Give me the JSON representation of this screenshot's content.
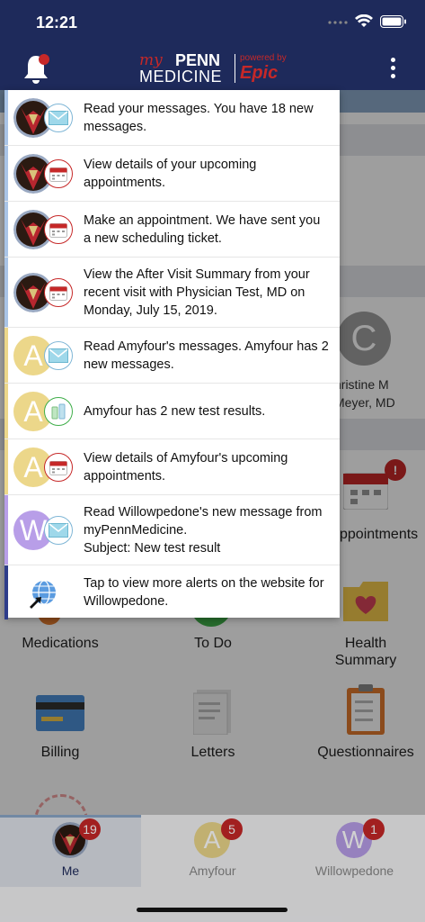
{
  "status_bar": {
    "time": "12:21"
  },
  "header": {
    "logo_my": "my",
    "logo_penn": "PENN",
    "logo_medicine": "MEDICINE",
    "powered_by": "powered by",
    "epic": "Epic"
  },
  "background": {
    "provider_initial": "C",
    "provider_line1": "hristine M",
    "provider_line2": "Meyer, MD",
    "appointments_label": "ppointments",
    "appointments_badge": "!",
    "tiles": {
      "medications": "Medications",
      "todo": "To Do",
      "health_summary": "Health\nSummary",
      "billing": "Billing",
      "letters": "Letters",
      "questionnaires": "Questionnaires"
    }
  },
  "alerts": [
    {
      "text": "Read your messages. You have 18 new messages.",
      "avatar": "me",
      "icon": "mail-icon",
      "bar_color": "#a9c4e6"
    },
    {
      "text": "View details of your upcoming appointments.",
      "avatar": "me",
      "icon": "calendar-icon",
      "bar_color": "#a9c4e6"
    },
    {
      "text": "Make an appointment. We have sent you a new scheduling ticket.",
      "avatar": "me",
      "icon": "calendar-icon",
      "bar_color": "#a9c4e6"
    },
    {
      "text": "View the After Visit Summary from your recent visit with Physician Test, MD on Monday, July 15, 2019.",
      "avatar": "me",
      "icon": "calendar-icon",
      "bar_color": "#a9c4e6"
    },
    {
      "text": "Read Amyfour's messages. Amyfour has 2 new messages.",
      "avatar": "A",
      "icon": "mail-icon",
      "bar_color": "#ecd78a"
    },
    {
      "text": "Amyfour has 2 new test results.",
      "avatar": "A",
      "icon": "test-tube-icon",
      "bar_color": "#ecd78a"
    },
    {
      "text": "View details of Amyfour's upcoming appointments.",
      "avatar": "A",
      "icon": "calendar-icon",
      "bar_color": "#ecd78a"
    },
    {
      "text": "Read Willowpedone's new message from myPennMedicine.\nSubject: New test result",
      "avatar": "W",
      "icon": "mail-icon",
      "bar_color": "#b89ee8"
    },
    {
      "text": "Tap to view more alerts on the website for Willowpedone.",
      "avatar": "globe",
      "icon": "globe-icon",
      "bar_color": "#2e3d8a"
    }
  ],
  "tabs": [
    {
      "label": "Me",
      "count": "19",
      "initial": ""
    },
    {
      "label": "Amyfour",
      "count": "5",
      "initial": "A"
    },
    {
      "label": "Willowpedone",
      "count": "1",
      "initial": "W"
    }
  ],
  "colors": {
    "header": "#1e2a5b",
    "brand_red": "#c62828",
    "amy": "#ecd78a",
    "willow": "#b89ee8"
  }
}
